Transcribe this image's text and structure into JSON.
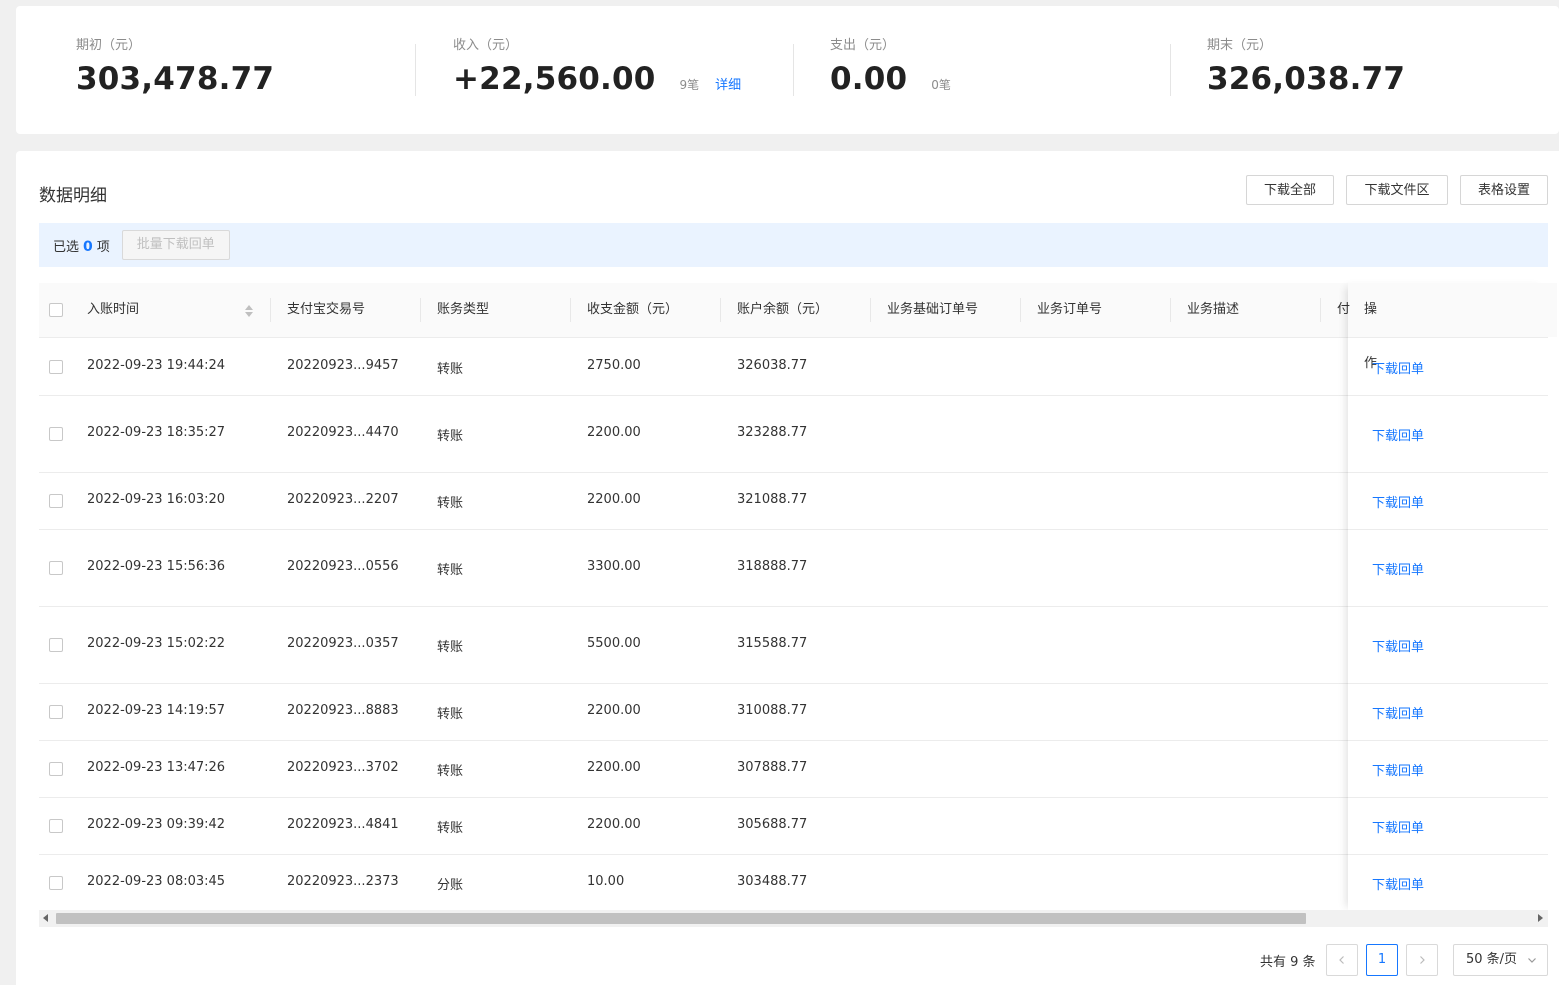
{
  "summary": {
    "opening": {
      "label": "期初（元）",
      "value": "303,478.77"
    },
    "income": {
      "label": "收入（元）",
      "value": "+22,560.00",
      "count": "9笔",
      "detail_link": "详细"
    },
    "expense": {
      "label": "支出（元）",
      "value": "0.00",
      "count": "0笔"
    },
    "closing": {
      "label": "期末（元）",
      "value": "326,038.77"
    }
  },
  "detail": {
    "title": "数据明细",
    "buttons": {
      "download_all": "下载全部",
      "download_area": "下载文件区",
      "table_settings": "表格设置"
    },
    "selection": {
      "prefix": "已选",
      "count": "0",
      "suffix": "项",
      "batch_button": "批量下载回单"
    }
  },
  "table": {
    "columns": [
      "入账时间",
      "支付宝交易号",
      "账务类型",
      "收支金额（元）",
      "账户余额（元）",
      "业务基础订单号",
      "业务订单号",
      "业务描述",
      "付",
      "操作"
    ],
    "rows": [
      {
        "time": "2022-09-23 19:44:24",
        "txn": "20220923...9457",
        "type": "转账",
        "amount": "2750.00",
        "balance": "326038.77",
        "action": "下载回单"
      },
      {
        "time": "2022-09-23 18:35:27",
        "txn": "20220923...4470",
        "type": "转账",
        "amount": "2200.00",
        "balance": "323288.77",
        "action": "下载回单"
      },
      {
        "time": "2022-09-23 16:03:20",
        "txn": "20220923...2207",
        "type": "转账",
        "amount": "2200.00",
        "balance": "321088.77",
        "action": "下载回单"
      },
      {
        "time": "2022-09-23 15:56:36",
        "txn": "20220923...0556",
        "type": "转账",
        "amount": "3300.00",
        "balance": "318888.77",
        "action": "下载回单"
      },
      {
        "time": "2022-09-23 15:02:22",
        "txn": "20220923...0357",
        "type": "转账",
        "amount": "5500.00",
        "balance": "315588.77",
        "action": "下载回单"
      },
      {
        "time": "2022-09-23 14:19:57",
        "txn": "20220923...8883",
        "type": "转账",
        "amount": "2200.00",
        "balance": "310088.77",
        "action": "下载回单"
      },
      {
        "time": "2022-09-23 13:47:26",
        "txn": "20220923...3702",
        "type": "转账",
        "amount": "2200.00",
        "balance": "307888.77",
        "action": "下载回单"
      },
      {
        "time": "2022-09-23 09:39:42",
        "txn": "20220923...4841",
        "type": "转账",
        "amount": "2200.00",
        "balance": "305688.77",
        "action": "下载回单"
      },
      {
        "time": "2022-09-23 08:03:45",
        "txn": "20220923...2373",
        "type": "分账",
        "amount": "10.00",
        "balance": "303488.77",
        "action": "下载回单"
      }
    ]
  },
  "pagination": {
    "total": "共有 9 条",
    "current_page": "1",
    "page_size": "50 条/页"
  },
  "colors": {
    "accent": "#1677ff",
    "selection_bar": "#eaf3ff"
  }
}
